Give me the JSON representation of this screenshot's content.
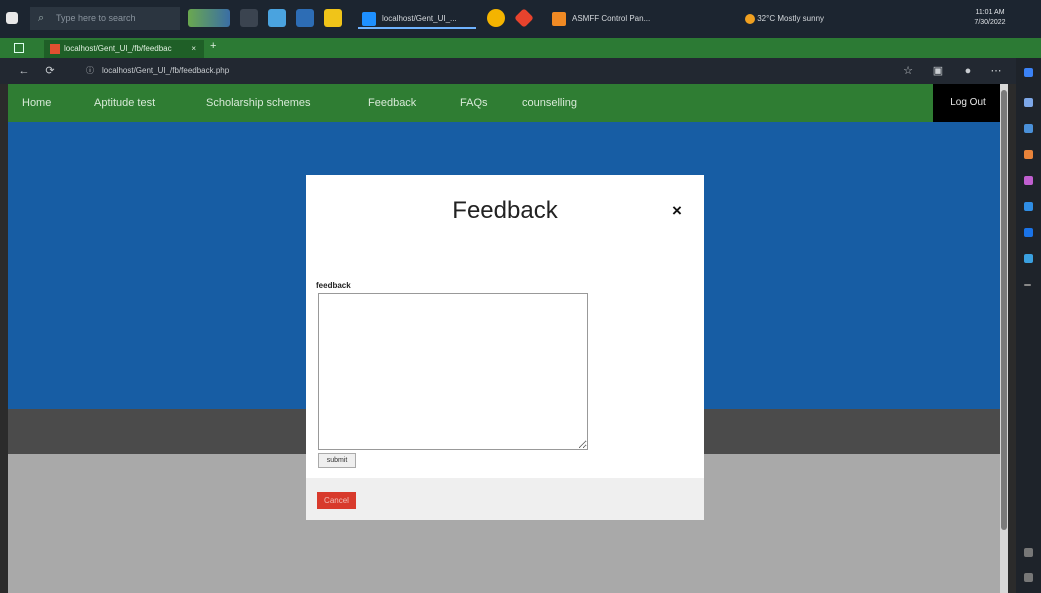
{
  "taskbar": {
    "search_placeholder": "Type here to search",
    "tasks": [
      {
        "label": "localhost/Gent_UI_...",
        "color": "#1e90ff"
      },
      {
        "label": "ASMFF Control Pan...",
        "color": "#f08a24"
      }
    ],
    "tray_weather": "32°C Mostly sunny",
    "clock_time": "11:01 AM",
    "clock_date": "7/30/2022"
  },
  "browser": {
    "tab_title": "localhost/Gent_UI_/fb/feedbac",
    "tab_close": "×",
    "new_tab": "+",
    "url": "localhost/Gent_UI_/fb/feedback.php",
    "url_host": "localhost",
    "back": "←",
    "reload": "⟳",
    "more": "⋯"
  },
  "nav": {
    "items": [
      "Home",
      "Aptitude test",
      "Scholarship schemes",
      "Feedback",
      "FAQs",
      "counselling"
    ],
    "logout": "Log Out"
  },
  "modal": {
    "title": "Feedback",
    "close": "×",
    "field_label": "feedback",
    "textarea_value": "",
    "submit": "submit",
    "cancel": "Cancel"
  },
  "colors": {
    "navbar": "#2f7d33",
    "hero": "#175da4",
    "cancel": "#d83a2c"
  }
}
